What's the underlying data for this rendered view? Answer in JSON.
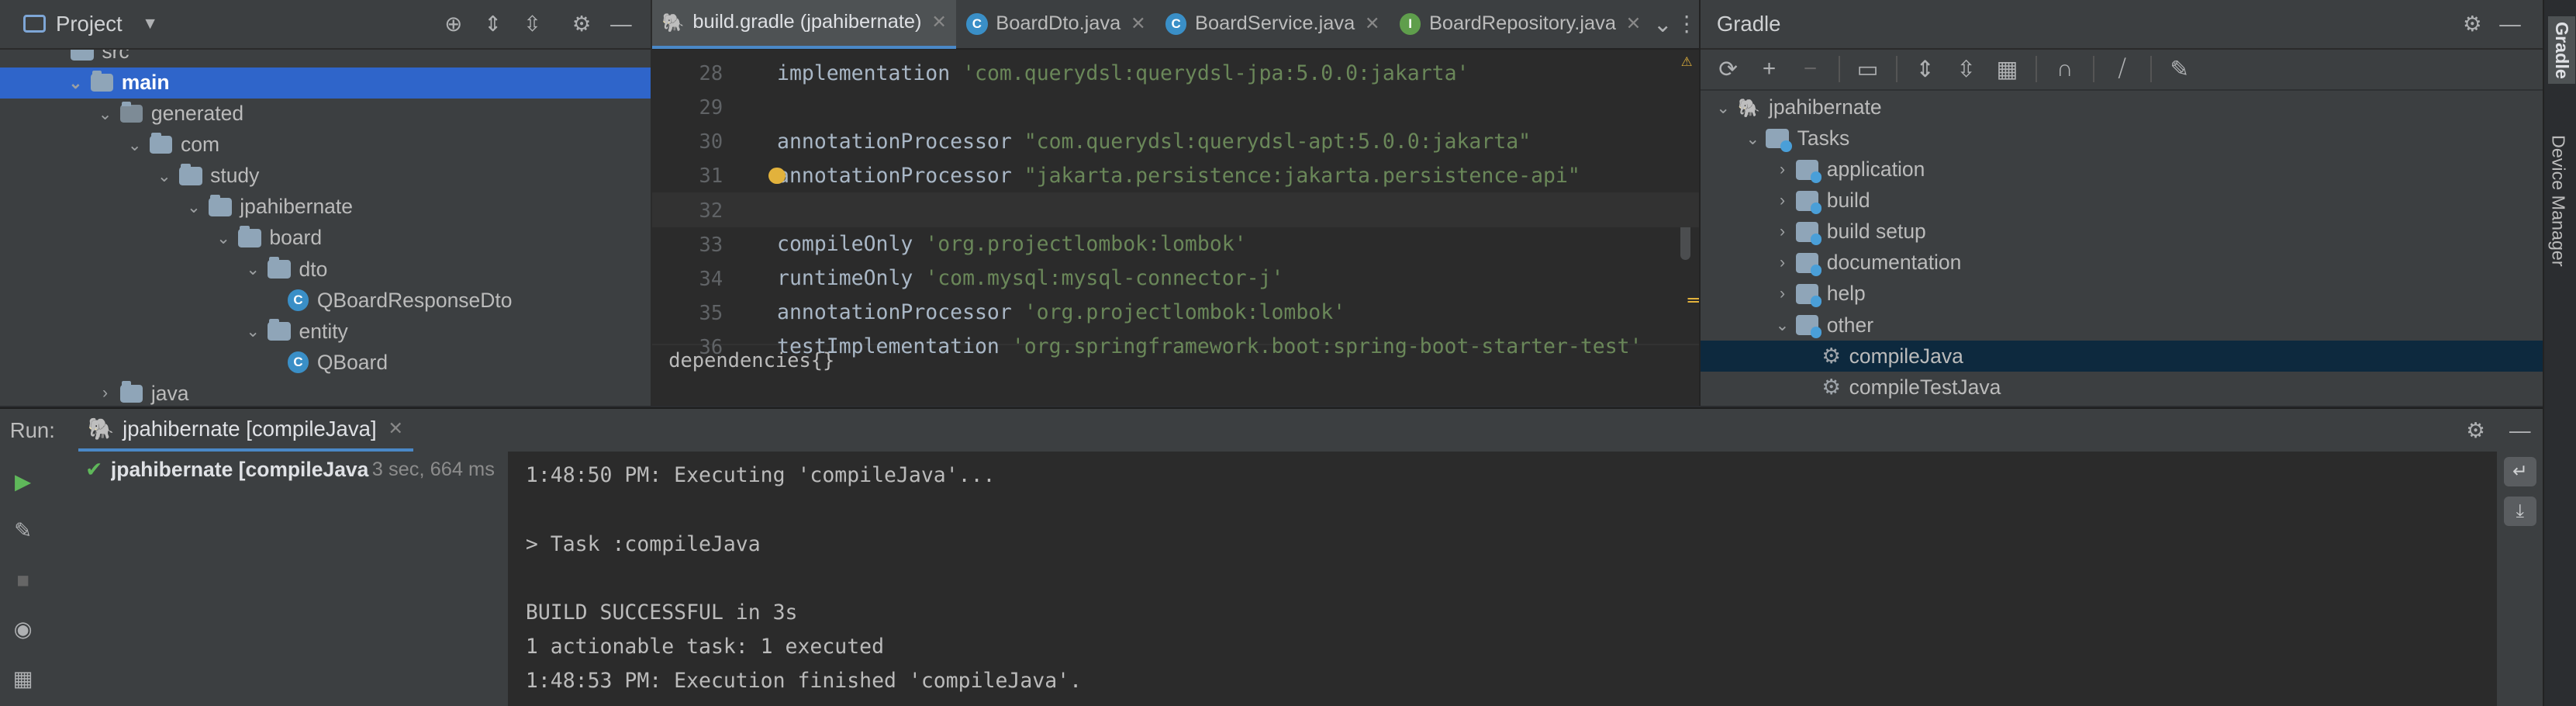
{
  "project": {
    "title": "Project",
    "tree": [
      {
        "label": "src",
        "indent": 40
      },
      {
        "label": "main",
        "indent": 40,
        "selected": true,
        "chev": "⌄"
      },
      {
        "label": "generated",
        "indent": 58,
        "chev": "⌄"
      },
      {
        "label": "com",
        "indent": 76,
        "chev": "⌄"
      },
      {
        "label": "study",
        "indent": 94,
        "chev": "⌄"
      },
      {
        "label": "jpahibernate",
        "indent": 112,
        "chev": "⌄"
      },
      {
        "label": "board",
        "indent": 130,
        "chev": "⌄"
      },
      {
        "label": "dto",
        "indent": 148,
        "chev": "⌄"
      },
      {
        "label": "QBoardResponseDto",
        "indent": 175,
        "cls": true
      },
      {
        "label": "entity",
        "indent": 148,
        "chev": "⌄"
      },
      {
        "label": "QBoard",
        "indent": 175,
        "cls": true
      },
      {
        "label": "java",
        "indent": 58,
        "chev": "›"
      }
    ]
  },
  "editor": {
    "tabs": [
      {
        "label": "build.gradle (jpahibernate)",
        "active": true,
        "icon": "gradle-elephant-icon"
      },
      {
        "label": "BoardDto.java",
        "icon": "class-icon"
      },
      {
        "label": "BoardService.java",
        "icon": "class-icon"
      },
      {
        "label": "BoardRepository.java",
        "icon": "interface-icon"
      }
    ],
    "lines": [
      {
        "num": "28",
        "code": "implementation ",
        "str": "'com.querydsl:querydsl-jpa:5.0.0:jakarta'"
      },
      {
        "num": "29",
        "code": "",
        "str": ""
      },
      {
        "num": "30",
        "code": "annotationProcessor ",
        "str": "\"com.querydsl:querydsl-apt:5.0.0:jakarta\""
      },
      {
        "num": "31",
        "code": "annotationProcessor ",
        "str": "\"jakarta.persistence:jakarta.persistence-api\""
      },
      {
        "num": "32",
        "code": "",
        "str": "",
        "current": true
      },
      {
        "num": "33",
        "code": "compileOnly ",
        "str": "'org.projectlombok:lombok'"
      },
      {
        "num": "34",
        "code": "runtimeOnly ",
        "str": "'com.mysql:mysql-connector-j'"
      },
      {
        "num": "35",
        "code": "annotationProcessor ",
        "str": "'org.projectlombok:lombok'"
      },
      {
        "num": "36",
        "code": "testImplementation ",
        "str": "'org.springframework.boot:spring-boot-starter-test'"
      }
    ],
    "breadcrumb": "dependencies{}"
  },
  "gradle": {
    "title": "Gradle",
    "tree": [
      {
        "label": "jpahibernate",
        "indent": 8,
        "chev": "⌄",
        "kind": "elephant"
      },
      {
        "label": "Tasks",
        "indent": 26,
        "chev": "⌄",
        "kind": "folder"
      },
      {
        "label": "application",
        "indent": 44,
        "chev": "›",
        "kind": "folder"
      },
      {
        "label": "build",
        "indent": 44,
        "chev": "›",
        "kind": "folder"
      },
      {
        "label": "build setup",
        "indent": 44,
        "chev": "›",
        "kind": "folder"
      },
      {
        "label": "documentation",
        "indent": 44,
        "chev": "›",
        "kind": "folder"
      },
      {
        "label": "help",
        "indent": 44,
        "chev": "›",
        "kind": "folder"
      },
      {
        "label": "other",
        "indent": 44,
        "chev": "⌄",
        "kind": "folder"
      },
      {
        "label": "compileJava",
        "indent": 74,
        "kind": "task",
        "selected": true
      },
      {
        "label": "compileTestJava",
        "indent": 74,
        "kind": "task"
      }
    ]
  },
  "side_strip": {
    "gradle": "Gradle",
    "device_manager": "Device Manager"
  },
  "run": {
    "label": "Run:",
    "tab": "jpahibernate [compileJava]",
    "tree_item": "jpahibernate [compileJava",
    "duration": "3 sec, 664 ms",
    "console": [
      "1:48:50 PM: Executing 'compileJava'...",
      "",
      "> Task :compileJava",
      "",
      "BUILD SUCCESSFUL in 3s",
      "1 actionable task: 1 executed",
      "1:48:53 PM: Execution finished 'compileJava'."
    ]
  },
  "colors": {
    "accent": "#2f65ca",
    "string": "#6a8759",
    "success": "#5fb85a",
    "run": "#5fb85a"
  }
}
